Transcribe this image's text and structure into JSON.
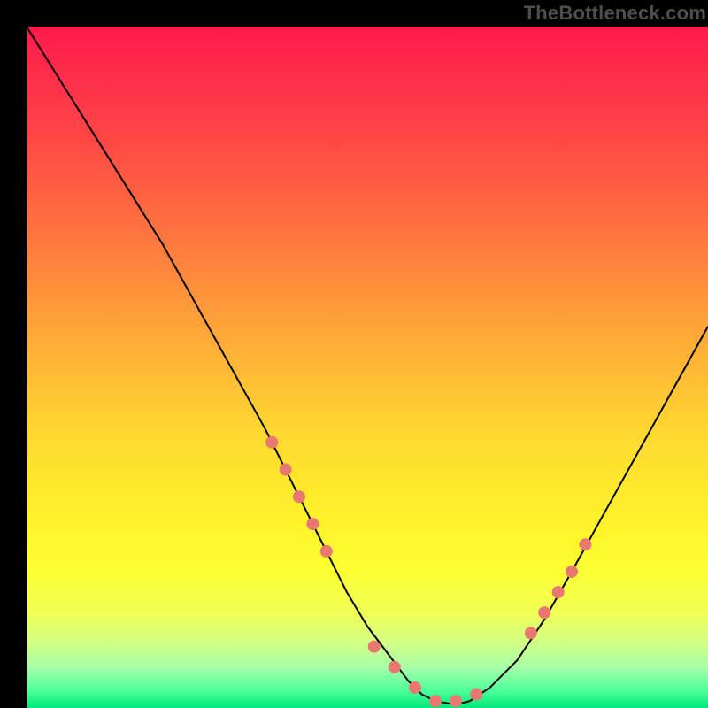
{
  "watermark": "TheBottleneck.com",
  "chart_data": {
    "type": "line",
    "title": "",
    "xlabel": "",
    "ylabel": "",
    "xlim": [
      0,
      100
    ],
    "ylim": [
      0,
      100
    ],
    "grid": false,
    "legend": false,
    "background_gradient": {
      "direction": "vertical",
      "stops": [
        {
          "pos": 0,
          "color": "#ff1a4d",
          "meaning": "high-bottleneck"
        },
        {
          "pos": 50,
          "color": "#ffd930",
          "meaning": "moderate"
        },
        {
          "pos": 100,
          "color": "#00e87a",
          "meaning": "optimal"
        }
      ]
    },
    "series": [
      {
        "name": "bottleneck-curve",
        "color": "#000000",
        "x": [
          0,
          5,
          10,
          15,
          20,
          25,
          30,
          35,
          40,
          43,
          47,
          50,
          53,
          56,
          58,
          60,
          63,
          65,
          68,
          72,
          76,
          80,
          85,
          90,
          95,
          100
        ],
        "values": [
          100,
          92,
          84,
          76,
          68,
          59,
          50,
          41,
          31,
          25,
          17,
          12,
          8,
          4,
          2,
          1,
          0.5,
          1,
          3,
          7,
          13,
          20,
          29,
          38,
          47,
          56
        ]
      }
    ],
    "markers": {
      "name": "sample-points",
      "color": "#e87870",
      "radius": 7,
      "x": [
        36,
        38,
        40,
        42,
        44,
        51,
        54,
        57,
        60,
        63,
        66,
        74,
        76,
        78,
        80,
        82
      ],
      "values": [
        39,
        35,
        31,
        27,
        23,
        9,
        6,
        3,
        1,
        1,
        2,
        11,
        14,
        17,
        20,
        24
      ]
    }
  }
}
